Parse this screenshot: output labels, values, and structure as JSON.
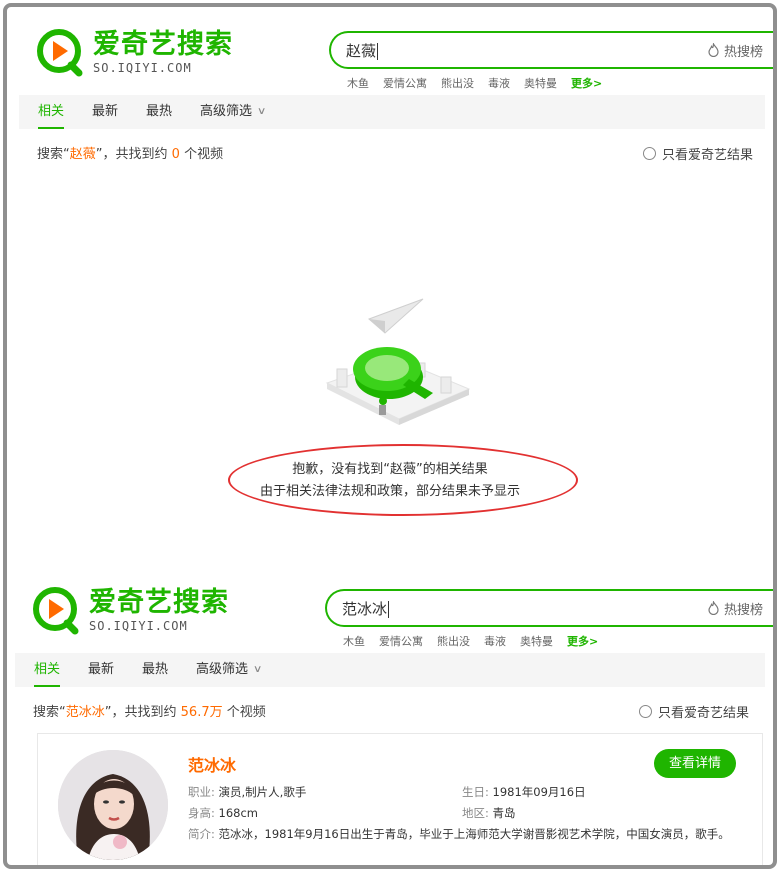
{
  "logo": {
    "title": "爱奇艺搜索",
    "subtitle": "SO.IQIYI.COM"
  },
  "hot_rank_label": "热搜榜",
  "hot_words": [
    "木鱼",
    "爱情公寓",
    "熊出没",
    "毒液",
    "奥特曼"
  ],
  "hot_more": "更多>",
  "tabs": [
    {
      "label": "相关",
      "active": true
    },
    {
      "label": "最新",
      "active": false
    },
    {
      "label": "最热",
      "active": false
    },
    {
      "label": "高级筛选",
      "active": false
    }
  ],
  "iqiyi_only_label": "只看爱奇艺结果",
  "top": {
    "query": "赵薇",
    "result_prefix": "搜索“",
    "result_mid": "”，共找到约",
    "count": "0",
    "result_suffix": "个视频",
    "sorry_line1": "抱歉，没有找到“赵薇”的相关结果",
    "sorry_line2": "由于相关法律法规和政策，部分结果未予显示"
  },
  "bottom": {
    "query": "范冰冰",
    "result_prefix": "搜索“",
    "result_mid": "”，共找到约",
    "count": "56.7万",
    "result_suffix": "个视频",
    "card": {
      "name": "范冰冰",
      "detail_button": "查看详情",
      "occupation_label": "职业: ",
      "occupation": "演员,制片人,歌手",
      "birthday_label": "生日: ",
      "birthday": "1981年09月16日",
      "height_label": "身高: ",
      "height": "168cm",
      "region_label": "地区: ",
      "region": "青岛",
      "bio_label": "简介: ",
      "bio": "范冰冰，1981年9月16日出生于青岛，毕业于上海师范大学谢晋影视艺术学院，中国女演员，歌手。"
    }
  },
  "colors": {
    "brand_green": "#1fb500",
    "highlight_orange": "#ff6a00",
    "annotation_red": "#e23131"
  },
  "icons": [
    "iqiyi-logo-icon",
    "flame-icon",
    "chevron-down-icon",
    "radio-icon",
    "paper-plane-icon",
    "magnifier-illustration-icon"
  ]
}
